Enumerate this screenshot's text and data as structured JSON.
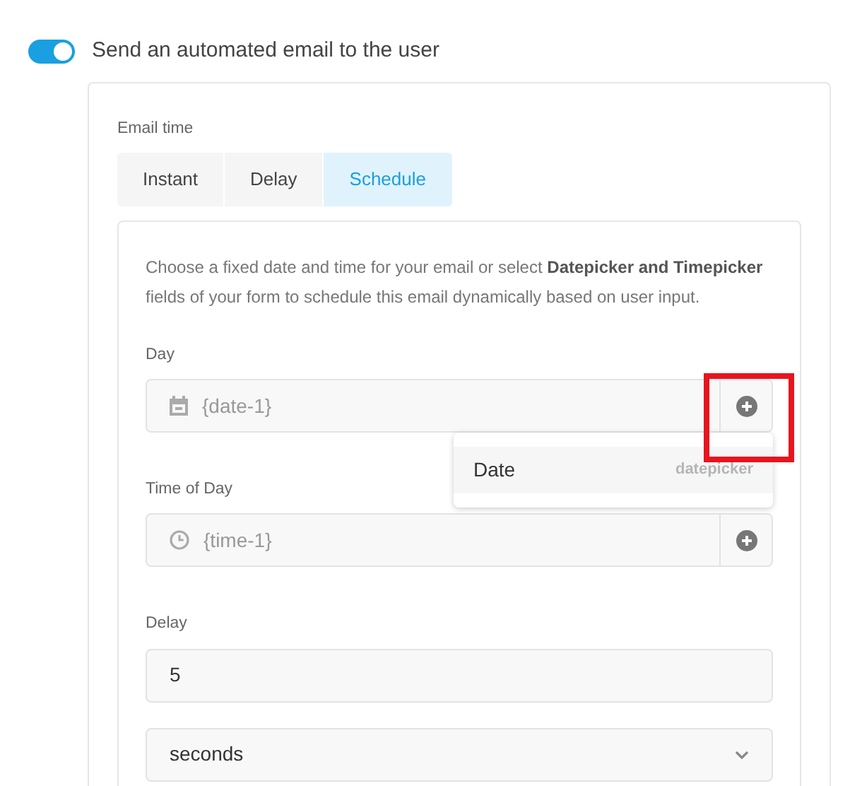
{
  "toggle": {
    "on": true,
    "label": "Send an automated email to the user"
  },
  "email_time": {
    "label": "Email time",
    "tabs": [
      {
        "label": "Instant",
        "selected": false
      },
      {
        "label": "Delay",
        "selected": false
      },
      {
        "label": "Schedule",
        "selected": true
      }
    ]
  },
  "description": "Choose a fixed date and time for your email or select **Datepicker and Timepicker** fields of your form to schedule this email dynamically based on user input.",
  "fields": [
    {
      "kind": "picker",
      "label": "Day",
      "value": "{date-1}",
      "highlighted": true,
      "dropdown": [
        {
          "label": "Date",
          "hint": "datepicker"
        }
      ]
    },
    {
      "kind": "picker",
      "label": "Time of Day",
      "value": "{time-1}"
    },
    {
      "kind": "text",
      "label": "Delay",
      "value": "5"
    },
    {
      "kind": "select",
      "value": "seconds"
    }
  ]
}
